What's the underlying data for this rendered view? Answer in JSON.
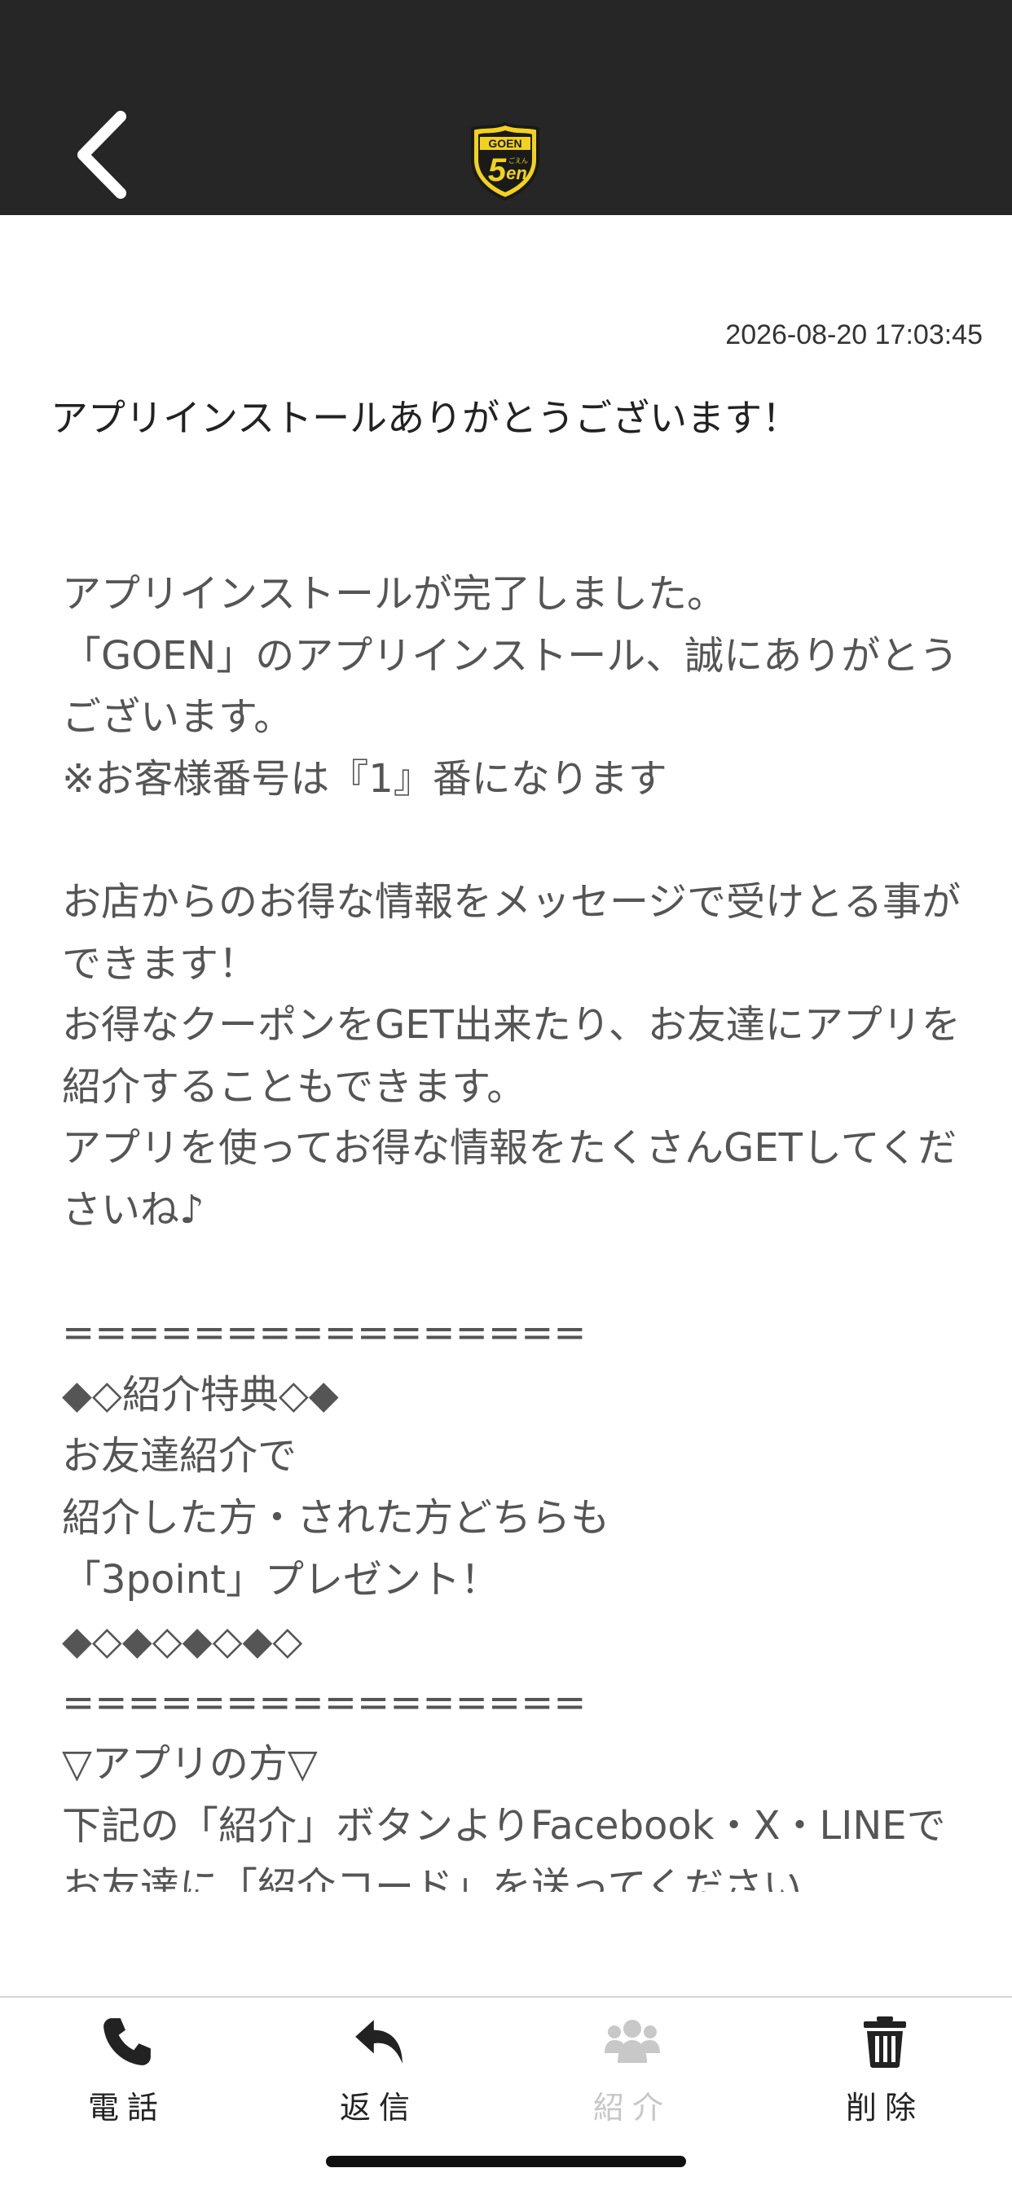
{
  "header": {
    "back_icon": "chevron-left-icon",
    "logo_text_top": "GOEN",
    "logo_text_main": "5en",
    "logo_text_small": "ごえん",
    "logo_color": "#f2d21b"
  },
  "message": {
    "timestamp": "2026-08-20 17:03:45",
    "title": "アプリインストールありがとうございます！",
    "body": "アプリインストールが完了しました。\n「GOEN」のアプリインストール、誠にありがとうございます。\n※お客様番号は『1』番になります\n\nお店からのお得な情報をメッセージで受けとる事ができます！\nお得なクーポンをGET出来たり、お友達にアプリを紹介することもできます。\nアプリを使ってお得な情報をたくさんGETしてくださいね♪\n\n================\n◆◇紹介特典◇◆\nお友達紹介で\n紹介した方・された方どちらも\n「3point」プレゼント！\n◆◇◆◇◆◇◆◇\n================\n▽アプリの方▽\n下記の「紹介」ボタンよりFacebook・X・LINEでお友達に「紹介コード」を送ってください"
  },
  "tabbar": {
    "tabs": [
      {
        "label": "電話",
        "icon": "phone-icon",
        "enabled": true
      },
      {
        "label": "返信",
        "icon": "reply-icon",
        "enabled": true
      },
      {
        "label": "紹介",
        "icon": "users-icon",
        "enabled": false
      },
      {
        "label": "削除",
        "icon": "trash-icon",
        "enabled": true
      }
    ],
    "active_color": "#222222",
    "disabled_color": "#c8c8c8"
  }
}
